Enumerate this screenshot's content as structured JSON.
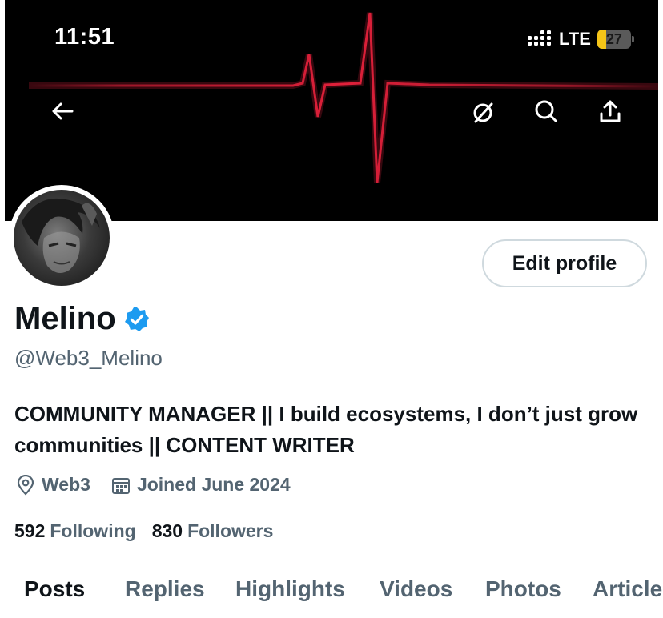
{
  "status_bar": {
    "time": "11:51",
    "network": "LTE",
    "battery": "27"
  },
  "header": {
    "back_icon": "arrow-left-icon",
    "grok_icon": "grok-icon",
    "search_icon": "search-icon",
    "share_icon": "share-icon"
  },
  "profile": {
    "name": "Melino",
    "handle": "@Web3_Melino",
    "bio": "COMMUNITY MANAGER || I build ecosystems, I don’t just grow communities || CONTENT WRITER",
    "location": "Web3",
    "joined": "Joined June 2024",
    "following_count": "592",
    "following_label": "Following",
    "followers_count": "830",
    "followers_label": "Followers",
    "edit_label": "Edit profile"
  },
  "tabs": [
    {
      "label": "Posts",
      "active": true
    },
    {
      "label": "Replies"
    },
    {
      "label": "Highlights"
    },
    {
      "label": "Videos"
    },
    {
      "label": "Photos"
    },
    {
      "label": "Article"
    }
  ],
  "colors": {
    "text": "#0f1419",
    "secondary": "#536471",
    "verified": "#1d9bf0",
    "pulse": "#e0203a",
    "battery": "#f5c518"
  }
}
